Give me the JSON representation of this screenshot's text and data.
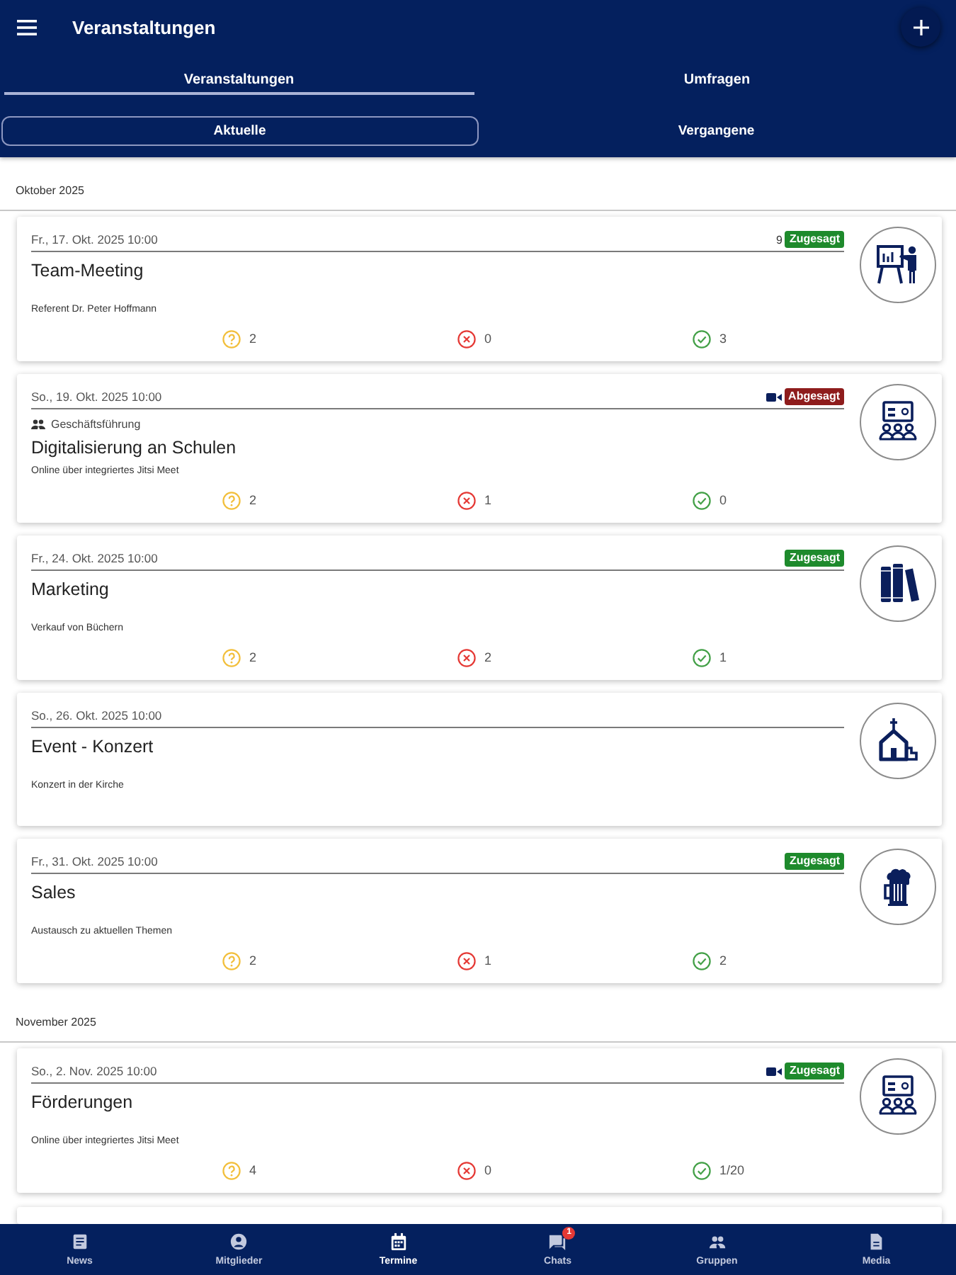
{
  "app_bar": {
    "title": "Veranstaltungen"
  },
  "tabs": [
    {
      "label": "Veranstaltungen",
      "selected": true
    },
    {
      "label": "Umfragen",
      "selected": false
    }
  ],
  "filters": [
    {
      "label": "Aktuelle",
      "selected": true
    },
    {
      "label": "Vergangene",
      "selected": false
    }
  ],
  "sections": [
    {
      "heading": "Oktober 2025",
      "events": [
        {
          "kind": "presentation",
          "date": "Fr., 17. Okt. 2025 10:00",
          "count": "9",
          "online": false,
          "status": {
            "label": "Zugesagt",
            "color": "#1e8a2c"
          },
          "title": "Team-Meeting",
          "description": "Referent Dr. Peter Hoffmann",
          "responses": [
            {
              "kind": "maybe",
              "count": "2"
            },
            {
              "kind": "declined",
              "count": "0"
            },
            {
              "kind": "accepted",
              "count": "3"
            }
          ]
        },
        {
          "kind": "seminar",
          "date": "So., 19. Okt. 2025 10:00",
          "online": true,
          "status": {
            "label": "Abgesagt",
            "color": "#8e1c1c"
          },
          "group": "Geschäftsführung",
          "title": "Digitalisierung an Schulen",
          "description": "Online über integriertes Jitsi Meet",
          "responses": [
            {
              "kind": "maybe",
              "count": "2"
            },
            {
              "kind": "declined",
              "count": "1"
            },
            {
              "kind": "accepted",
              "count": "0"
            }
          ]
        },
        {
          "kind": "books",
          "date": "Fr., 24. Okt. 2025 10:00",
          "online": false,
          "status": {
            "label": "Zugesagt",
            "color": "#1e8a2c"
          },
          "title": "Marketing",
          "description": "Verkauf von Büchern",
          "responses": [
            {
              "kind": "maybe",
              "count": "2"
            },
            {
              "kind": "declined",
              "count": "2"
            },
            {
              "kind": "accepted",
              "count": "1"
            }
          ]
        },
        {
          "kind": "church",
          "date": "So., 26. Okt. 2025 10:00",
          "online": false,
          "title": "Event - Konzert",
          "description": "Konzert in der Kirche"
        },
        {
          "kind": "beer",
          "date": "Fr., 31. Okt. 2025 10:00",
          "online": false,
          "status": {
            "label": "Zugesagt",
            "color": "#1e8a2c"
          },
          "title": "Sales",
          "description": "Austausch zu aktuellen Themen",
          "responses": [
            {
              "kind": "maybe",
              "count": "2"
            },
            {
              "kind": "declined",
              "count": "1"
            },
            {
              "kind": "accepted",
              "count": "2"
            }
          ]
        }
      ]
    },
    {
      "heading": "November 2025",
      "events": [
        {
          "kind": "seminar",
          "date": "So., 2. Nov. 2025 10:00",
          "online": true,
          "status": {
            "label": "Zugesagt",
            "color": "#1e8a2c"
          },
          "title": "Förderungen",
          "description": "Online über integriertes Jitsi Meet",
          "responses": [
            {
              "kind": "maybe",
              "count": "4"
            },
            {
              "kind": "declined",
              "count": "0"
            },
            {
              "kind": "accepted",
              "count": "1/20"
            }
          ]
        }
      ]
    }
  ],
  "bottom_nav": [
    {
      "kind": "news",
      "label": "News",
      "selected": false
    },
    {
      "kind": "members",
      "label": "Mitglieder",
      "selected": false
    },
    {
      "kind": "calendar",
      "label": "Termine",
      "selected": true
    },
    {
      "kind": "chats",
      "label": "Chats",
      "selected": false,
      "badge": "1"
    },
    {
      "kind": "groups",
      "label": "Gruppen",
      "selected": false
    },
    {
      "kind": "media",
      "label": "Media",
      "selected": false
    }
  ]
}
